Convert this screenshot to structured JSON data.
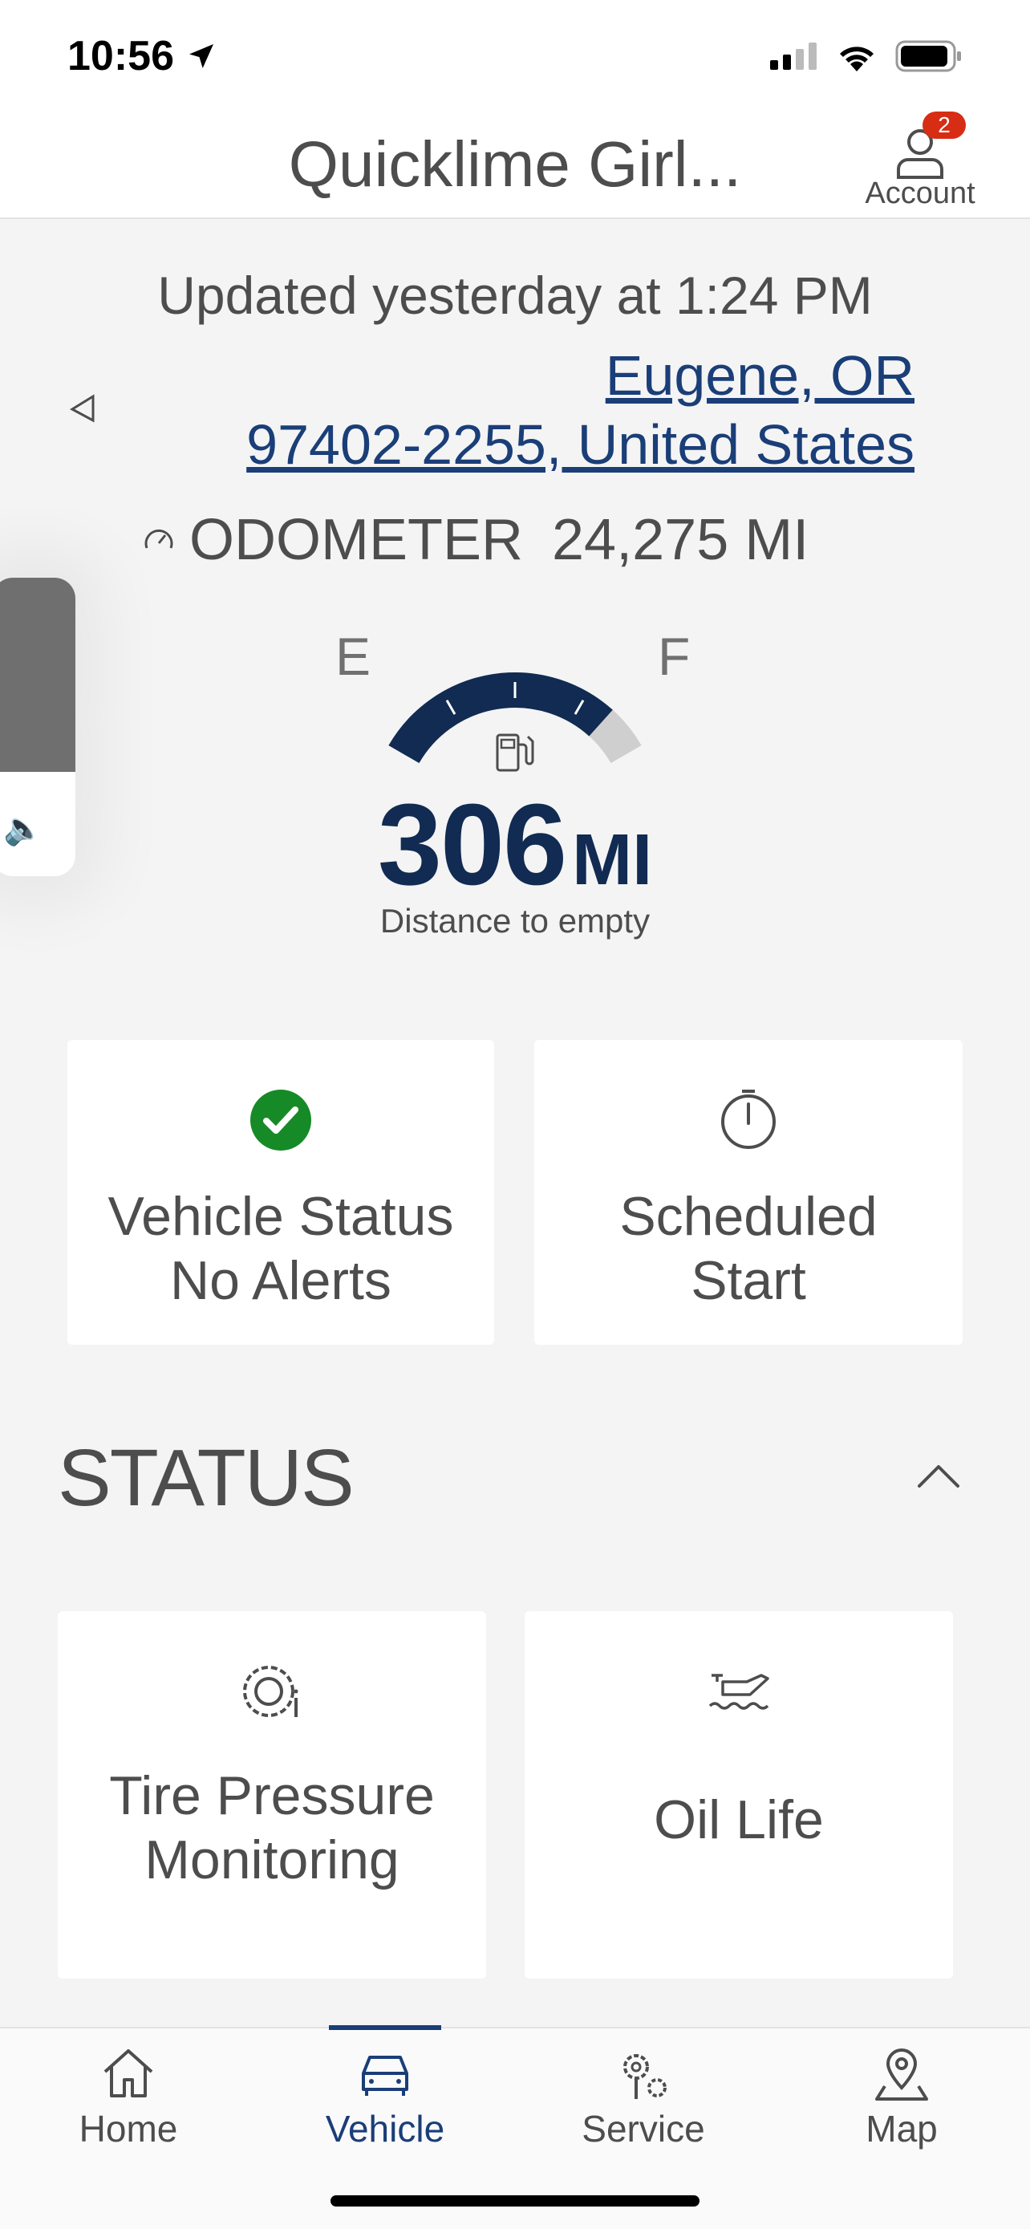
{
  "status_bar": {
    "time": "10:56"
  },
  "header": {
    "title": "Quicklime Girl...",
    "account_label": "Account",
    "account_badge": "2"
  },
  "vehicle": {
    "updated": "Updated yesterday at 1:24 PM",
    "address_line1": "Eugene, OR",
    "address_line2": "97402-2255, United States",
    "odometer_label": "ODOMETER",
    "odometer_value": "24,275 MI",
    "gauge_empty": "E",
    "gauge_full": "F",
    "fuel_level": 0.85,
    "range_value": "306",
    "range_unit": "MI",
    "range_label": "Distance to empty"
  },
  "volume_level": 0.65,
  "quick_cards": [
    {
      "title": "Vehicle Status",
      "subtitle": "No Alerts",
      "icon": "check-circle-icon"
    },
    {
      "title": "Scheduled",
      "subtitle": "Start",
      "icon": "clock-icon"
    }
  ],
  "status_section": {
    "title": "STATUS",
    "items": [
      {
        "line1": "Tire Pressure",
        "line2": "Monitoring",
        "icon": "tire-pressure-icon"
      },
      {
        "line1": "Oil Life",
        "icon": "oil-can-icon"
      }
    ]
  },
  "tabs": [
    {
      "label": "Home",
      "icon": "house-icon"
    },
    {
      "label": "Vehicle",
      "icon": "car-icon",
      "active": true
    },
    {
      "label": "Service",
      "icon": "gears-icon"
    },
    {
      "label": "Map",
      "icon": "map-pin-icon"
    }
  ],
  "colors": {
    "brand": "#1a3e78",
    "range": "#112b52",
    "ok": "#178a28",
    "badge": "#d62d14"
  }
}
